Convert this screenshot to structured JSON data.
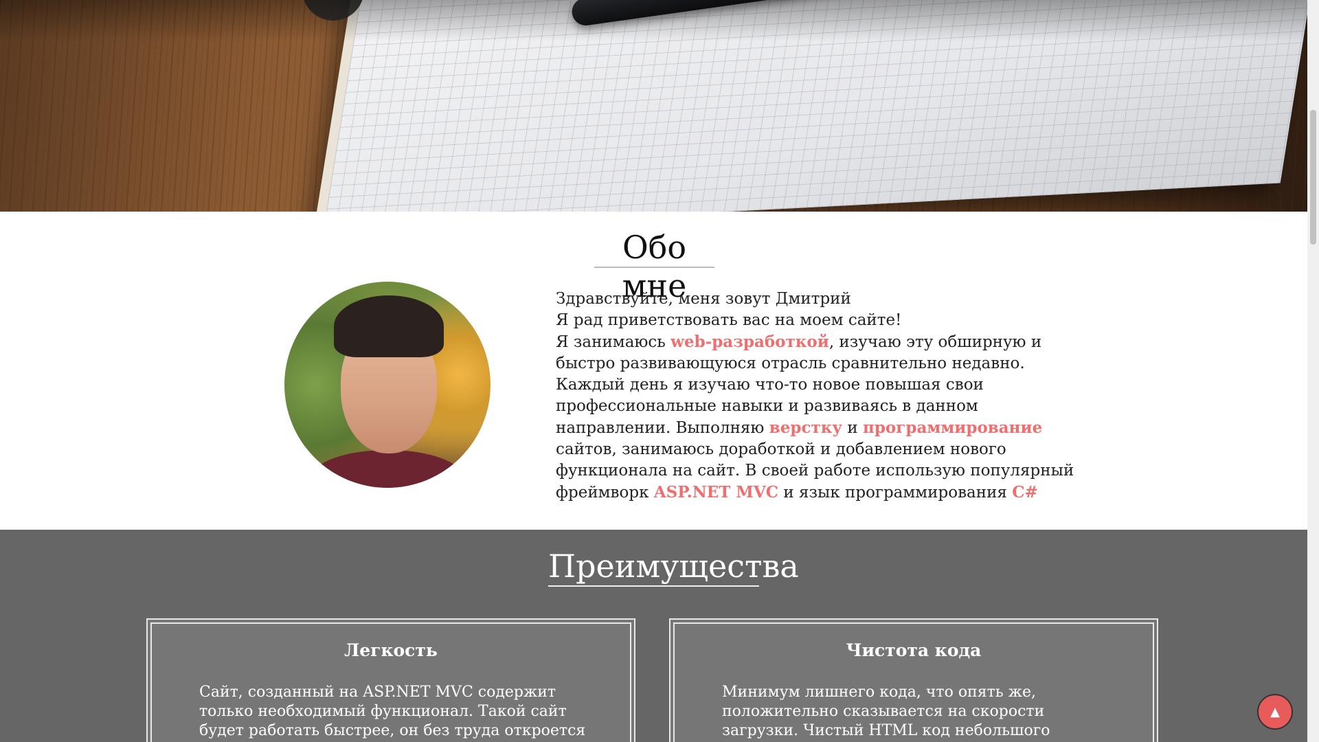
{
  "about": {
    "title": "Обо мне",
    "line1": "Здравствуйте, меня зовут Дмитрий",
    "line2": "Я рад приветствовать вас на моем сайте!",
    "p_start": "Я занимаюсь ",
    "hl_web": "web-разработкой",
    "p_mid1": ", изучаю эту обширную и быстро развивающуюся отрасль сравнительно недавно. Каждый день я изучаю что-то новое повышая свои профессиональные навыки и развиваясь в данном направлении. Выполняю ",
    "hl_layout": "верстку",
    "p_and": " и ",
    "hl_programming": "программирование",
    "p_mid2": " сайтов, занимаюсь доработкой и добавлением нового функционала на сайт. В своей работе использую популярный фреймворк ",
    "hl_framework": "ASP.NET MVC",
    "p_mid3": " и язык программирования ",
    "hl_language": "C#"
  },
  "advantages": {
    "title": "Преимущества",
    "cards": [
      {
        "title": "Легкость",
        "text": "Сайт, созданный на ASP.NET MVC содержит только необходимый функционал. Такой сайт будет работать быстрее, он без труда откроется на"
      },
      {
        "title": "Чистота кода",
        "text": "Минимум лишнего кода, что опять же, положительно сказывается на скорости загрузки. Чистый HTML код небольшого размера"
      }
    ]
  },
  "scroll_top": {
    "icon": "▲"
  },
  "colors": {
    "accent": "#ef6f6f",
    "section_bg": "#666666",
    "button": "#e75b5b"
  }
}
